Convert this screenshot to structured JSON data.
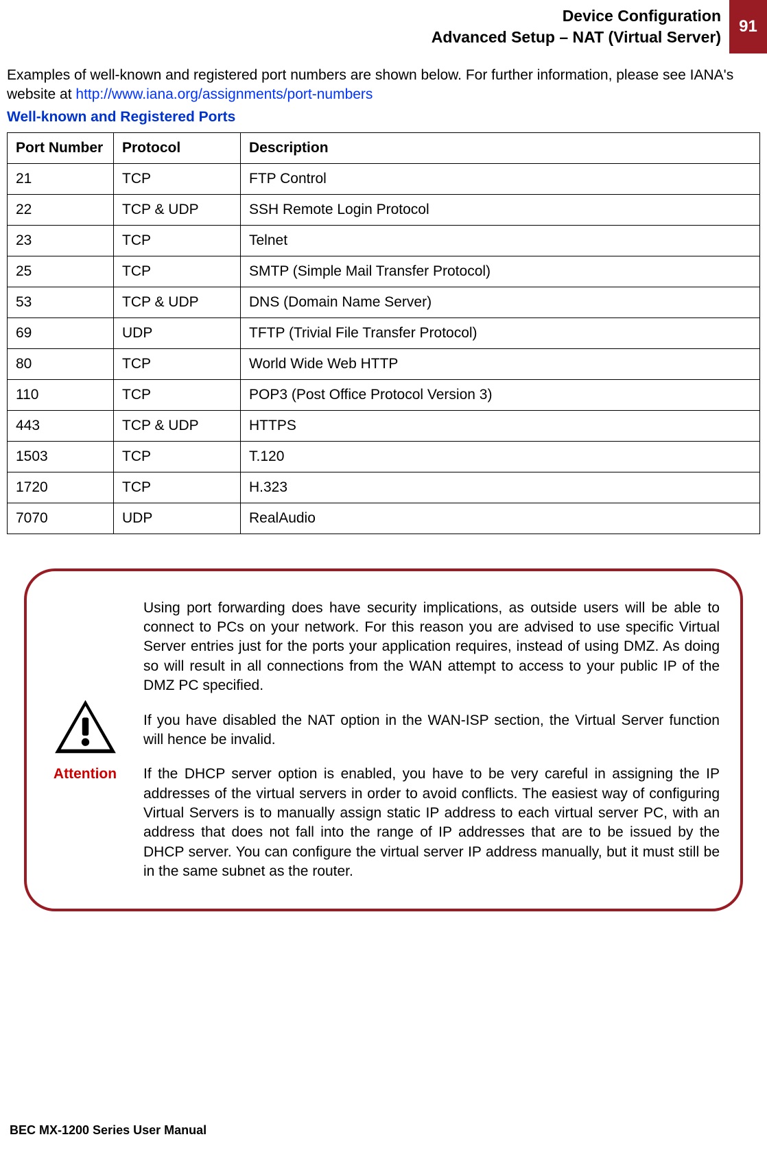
{
  "header": {
    "line1": "Device Configuration",
    "line2": "Advanced Setup – NAT (Virtual Server)",
    "page_number": "91"
  },
  "intro": {
    "text_before_link": "Examples of well-known and registered port numbers are shown below. For further information, please see IANA's website at ",
    "link_text": "http://www.iana.org/assignments/port-numbers"
  },
  "section_title": "Well-known and Registered Ports",
  "table": {
    "headers": [
      "Port Number",
      "Protocol",
      "Description"
    ],
    "rows": [
      {
        "port": "21",
        "protocol": "TCP",
        "description": "FTP Control"
      },
      {
        "port": "22",
        "protocol": "TCP & UDP",
        "description": "SSH Remote Login Protocol"
      },
      {
        "port": "23",
        "protocol": "TCP",
        "description": "Telnet"
      },
      {
        "port": "25",
        "protocol": "TCP",
        "description": "SMTP (Simple Mail Transfer Protocol)"
      },
      {
        "port": "53",
        "protocol": "TCP & UDP",
        "description": "DNS (Domain Name Server)"
      },
      {
        "port": "69",
        "protocol": "UDP",
        "description": "TFTP (Trivial File Transfer Protocol)"
      },
      {
        "port": "80",
        "protocol": "TCP",
        "description": "World Wide Web HTTP"
      },
      {
        "port": "110",
        "protocol": "TCP",
        "description": "POP3 (Post Office Protocol Version 3)"
      },
      {
        "port": "443",
        "protocol": "TCP & UDP",
        "description": "HTTPS"
      },
      {
        "port": "1503",
        "protocol": "TCP",
        "description": "T.120"
      },
      {
        "port": "1720",
        "protocol": "TCP",
        "description": "H.323"
      },
      {
        "port": "7070",
        "protocol": "UDP",
        "description": "RealAudio"
      }
    ]
  },
  "attention": {
    "label": "Attention",
    "p1": "Using port forwarding does have security implications, as outside users will be able to connect to PCs on your network. For this reason you are advised to use specific Virtual Server entries just for the ports your application requires, instead of using DMZ. As doing so will result in all connections from the WAN attempt to access to your public IP of the DMZ PC specified.",
    "p2": "If you have disabled the NAT option in the WAN-ISP section, the Virtual Server function will hence be invalid.",
    "p3": "If the DHCP server option is enabled, you have to be very careful in assigning the IP addresses of the virtual servers in order to avoid conflicts. The easiest way of configuring Virtual Servers is to manually assign static IP address to each virtual server PC, with an address that does not fall into the range of IP addresses that are to be issued by the DHCP server. You can configure the virtual server IP address manually, but it must still be in the same subnet as the router."
  },
  "footer": "BEC MX-1200 Series User Manual"
}
